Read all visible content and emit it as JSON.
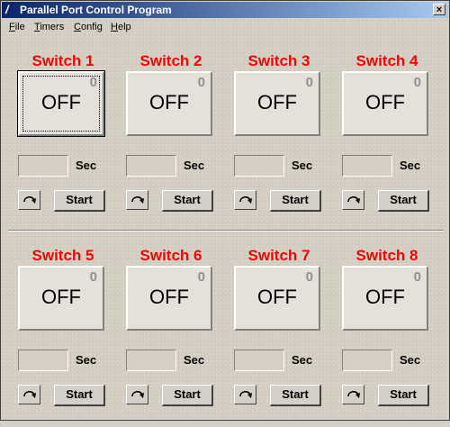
{
  "window": {
    "title": "Parallel Port Control Program",
    "close_glyph": "×",
    "app_icon": "feather-icon"
  },
  "menu": [
    {
      "label": "File",
      "mnemonic": "F"
    },
    {
      "label": "Timers",
      "mnemonic": "T"
    },
    {
      "label": "Config",
      "mnemonic": "C"
    },
    {
      "label": "Help",
      "mnemonic": "H"
    }
  ],
  "switches": [
    {
      "label": "Switch 1",
      "state": "OFF",
      "count": "0",
      "seconds": "",
      "sec_label": "Sec",
      "start_label": "Start"
    },
    {
      "label": "Switch 2",
      "state": "OFF",
      "count": "0",
      "seconds": "",
      "sec_label": "Sec",
      "start_label": "Start"
    },
    {
      "label": "Switch 3",
      "state": "OFF",
      "count": "0",
      "seconds": "",
      "sec_label": "Sec",
      "start_label": "Start"
    },
    {
      "label": "Switch 4",
      "state": "OFF",
      "count": "0",
      "seconds": "",
      "sec_label": "Sec",
      "start_label": "Start"
    },
    {
      "label": "Switch 5",
      "state": "OFF",
      "count": "0",
      "seconds": "",
      "sec_label": "Sec",
      "start_label": "Start"
    },
    {
      "label": "Switch 6",
      "state": "OFF",
      "count": "0",
      "seconds": "",
      "sec_label": "Sec",
      "start_label": "Start"
    },
    {
      "label": "Switch 7",
      "state": "OFF",
      "count": "0",
      "seconds": "",
      "sec_label": "Sec",
      "start_label": "Start"
    },
    {
      "label": "Switch 8",
      "state": "OFF",
      "count": "0",
      "seconds": "",
      "sec_label": "Sec",
      "start_label": "Start"
    }
  ],
  "colors": {
    "switch_label": "#ff0000",
    "titlebar_start": "#0a246a",
    "titlebar_end": "#a6caf0",
    "panel": "#d6d0c4"
  },
  "icons": {
    "repeat": "repeat-arrow-icon"
  }
}
